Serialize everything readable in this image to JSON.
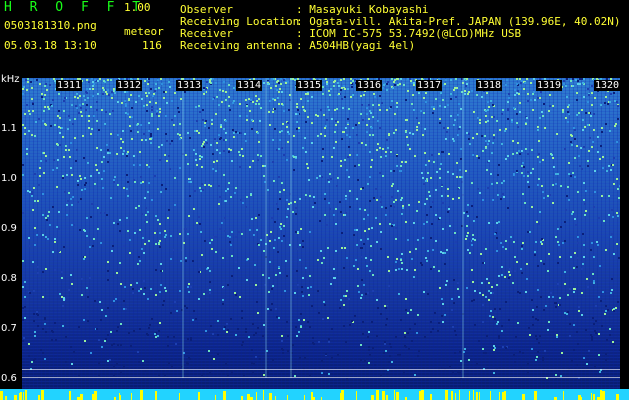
{
  "header": {
    "app_title": "H R O F F T",
    "version": "1.00",
    "filename": "0503181310.png",
    "mode": "meteor",
    "datetime": "05.03.18 13:10",
    "count": "116",
    "info": [
      {
        "label": "Observer",
        "value": ": Masayuki Kobayashi"
      },
      {
        "label": "Receiving Location",
        "value": ": Ogata-vill. Akita-Pref. JAPAN (139.96E, 40.02N)"
      },
      {
        "label": "Receiver",
        "value": ": ICOM IC-575 53.7492(@LCD)MHz USB"
      },
      {
        "label": "Receiving antenna",
        "value": ": A504HB(yagi 4el)"
      }
    ]
  },
  "axis": {
    "unit": "kHz",
    "y_labels": [
      "1.1",
      "1.0",
      "0.9",
      "0.8",
      "0.7",
      "0.6"
    ],
    "time_labels": [
      "1311",
      "1312",
      "1313",
      "1314",
      "1315",
      "1316",
      "1317",
      "1318",
      "1319",
      "1320"
    ]
  },
  "colors": {
    "header_text": "#ffff33",
    "title_green": "#19ff19",
    "spectrum_high": "#2f7fd0",
    "spectrum_low": "#071a6a",
    "noise_bar": "#22d3ff",
    "meteor_mark": "#ffff00"
  }
}
